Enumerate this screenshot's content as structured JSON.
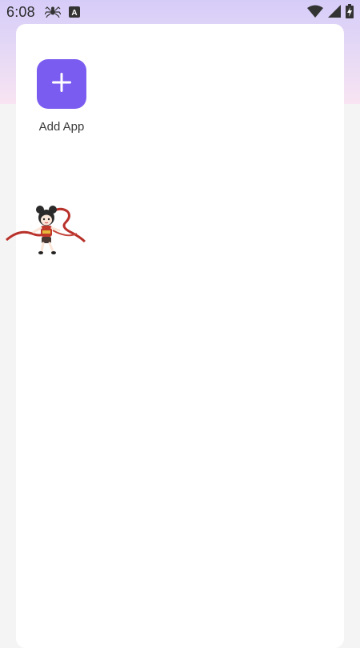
{
  "status_bar": {
    "time": "6:08",
    "left_icons": [
      "spider-icon",
      "keyboard-a-icon"
    ],
    "right_icons": [
      "wifi-icon",
      "cell-signal-icon",
      "battery-charging-icon"
    ],
    "keyboard_badge": "A"
  },
  "home": {
    "add_app": {
      "label": "Add App",
      "icon": "plus-icon",
      "tile_color": "#7b5cf0"
    }
  },
  "overlay": {
    "mascot_icon": "floating-character-mascot"
  },
  "colors": {
    "gradient_top": "#d6ccf8",
    "gradient_bottom": "#f8e4f2",
    "page_background": "#f4f4f5",
    "card_background": "#ffffff"
  }
}
